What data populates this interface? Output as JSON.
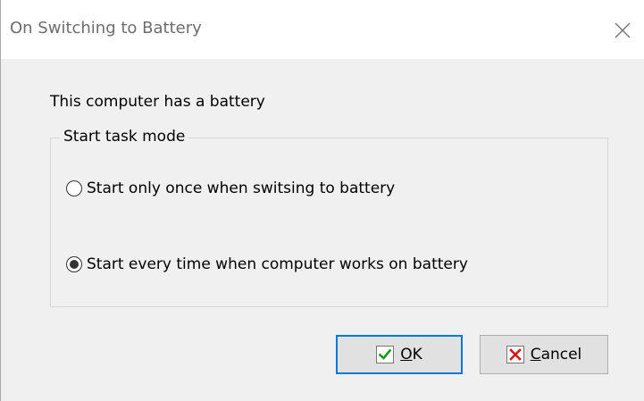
{
  "window": {
    "title": "On Switching to Battery"
  },
  "info_text": "This computer has a battery",
  "group": {
    "legend": "Start task mode",
    "options": [
      {
        "label": "Start only once when switsing to battery",
        "selected": false
      },
      {
        "label": "Start every time when computer works on battery",
        "selected": true
      }
    ]
  },
  "buttons": {
    "ok": {
      "mnemonic": "O",
      "rest": "K",
      "icon": "check-icon",
      "icon_color": "#1a9a1a"
    },
    "cancel": {
      "mnemonic": "C",
      "rest": "ancel",
      "icon": "x-icon",
      "icon_color": "#d11a1a"
    }
  },
  "colors": {
    "default_button_border": "#0078d7",
    "dialog_background": "#f0f0f0"
  }
}
